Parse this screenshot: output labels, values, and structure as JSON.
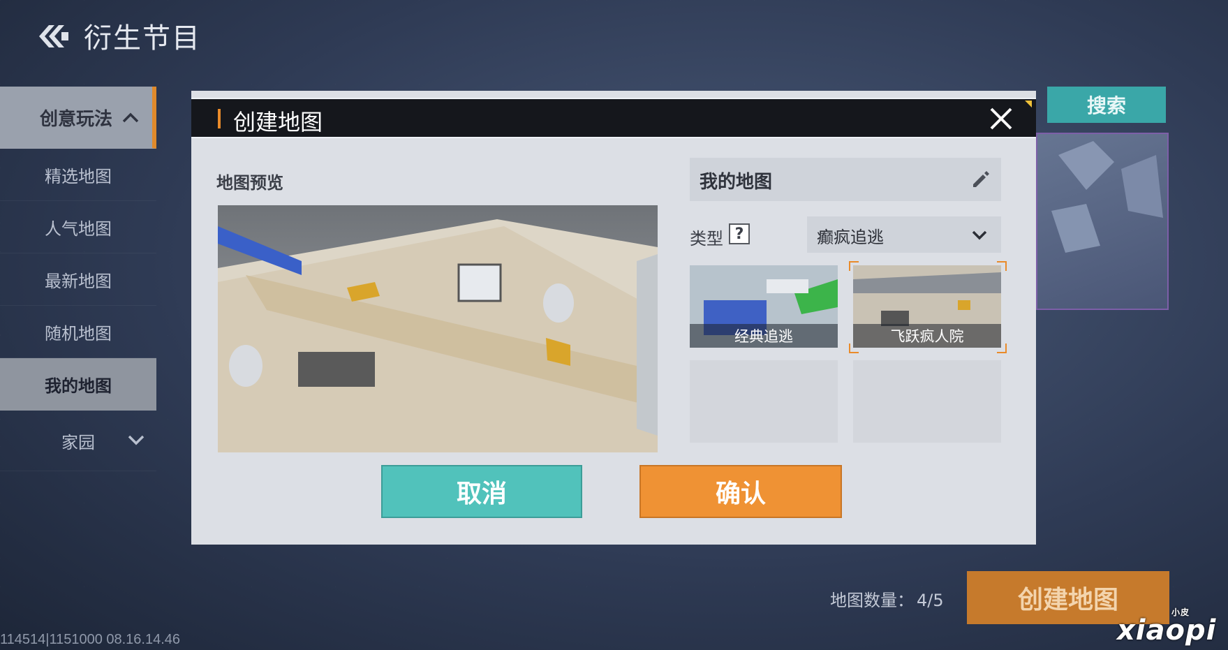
{
  "page": {
    "title": "衍生节目"
  },
  "sidebar": {
    "header": "创意玩法",
    "items": [
      {
        "label": "精选地图"
      },
      {
        "label": "人气地图"
      },
      {
        "label": "最新地图"
      },
      {
        "label": "随机地图"
      },
      {
        "label": "我的地图"
      }
    ],
    "home": "家园"
  },
  "background": {
    "search_label": "搜索",
    "map_count_label": "地图数量：",
    "map_count_value": "4/5",
    "create_label": "创建地图"
  },
  "modal": {
    "title": "创建地图",
    "preview_label": "地图预览",
    "map_name": "我的地图",
    "type_label": "类型",
    "help_glyph": "?",
    "type_value": "癫疯追逃",
    "templates": [
      {
        "label": "经典追逃"
      },
      {
        "label": "飞跃疯人院",
        "selected": true
      }
    ],
    "cancel_label": "取消",
    "confirm_label": "确认"
  },
  "footer": {
    "build_info": "114514|1151000 08.16.14.46"
  },
  "watermark": {
    "main": "xiaopi",
    "small": "小皮"
  },
  "colors": {
    "accent_orange": "#ef9234",
    "accent_teal": "#51c2bb"
  }
}
